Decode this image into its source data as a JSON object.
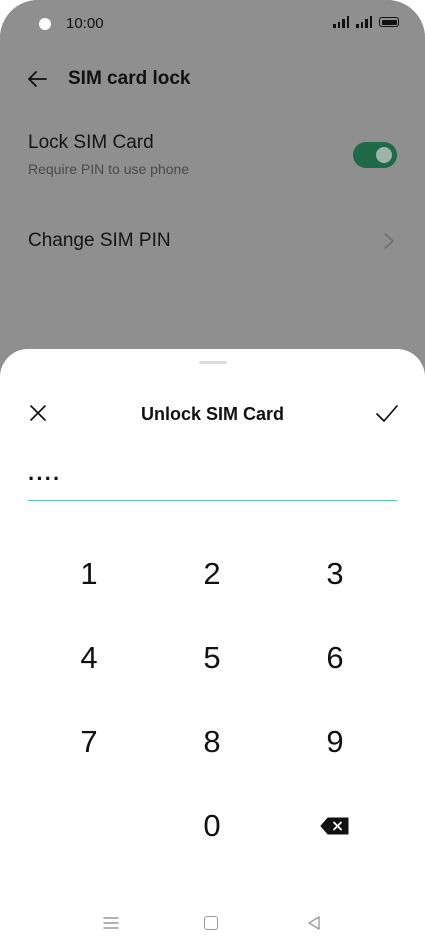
{
  "status_bar": {
    "time": "10:00"
  },
  "header": {
    "title": "SIM card lock"
  },
  "settings": {
    "lock_sim": {
      "title": "Lock SIM Card",
      "subtitle": "Require PIN to use phone",
      "enabled": true
    },
    "change_pin": {
      "title": "Change SIM PIN"
    }
  },
  "dialog": {
    "title": "Unlock SIM Card",
    "pin_value": "····",
    "keys": [
      "1",
      "2",
      "3",
      "4",
      "5",
      "6",
      "7",
      "8",
      "9",
      "0"
    ]
  },
  "icons": {
    "back": "arrow-left-icon",
    "close": "close-icon",
    "confirm": "check-icon",
    "backspace": "backspace-icon",
    "chevron": "chevron-right-icon"
  },
  "colors": {
    "toggle_on": "#1f6a49",
    "accent_underline": "#53c9a4"
  }
}
